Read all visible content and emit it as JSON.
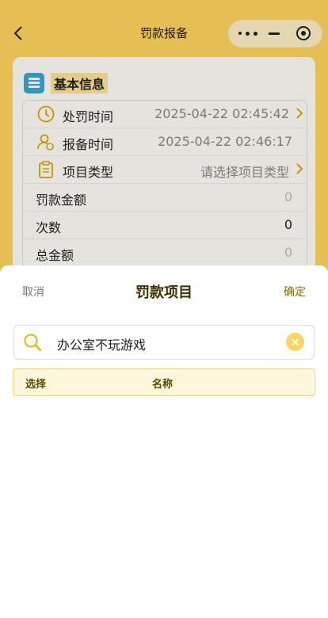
{
  "nav": {
    "title": "罚款报备"
  },
  "card": {
    "header": "基本信息",
    "rows": [
      {
        "label": "处罚时间",
        "value": "2025-04-22 02:45:42"
      },
      {
        "label": "报备时间",
        "value": "2025-04-22 02:46:17"
      },
      {
        "label": "项目类型",
        "value": "请选择项目类型"
      },
      {
        "label": "罚款金额",
        "value": "0"
      },
      {
        "label": "次数",
        "value": "0"
      },
      {
        "label": "总金额",
        "value": "0"
      }
    ]
  },
  "sheet": {
    "cancel": "取消",
    "title": "罚款项目",
    "confirm": "确定",
    "search_value": "办公室不玩游戏",
    "columns": [
      "选择",
      "名称"
    ]
  },
  "colors": {
    "accent": "#ffd45e",
    "brand_dark": "#3d3000"
  },
  "icons": [
    "back-icon",
    "more-icon",
    "minimize-icon",
    "target-icon",
    "book-icon",
    "clock-icon",
    "user-icon",
    "clipboard-icon",
    "chevron-right-icon",
    "search-icon",
    "clear-icon"
  ]
}
